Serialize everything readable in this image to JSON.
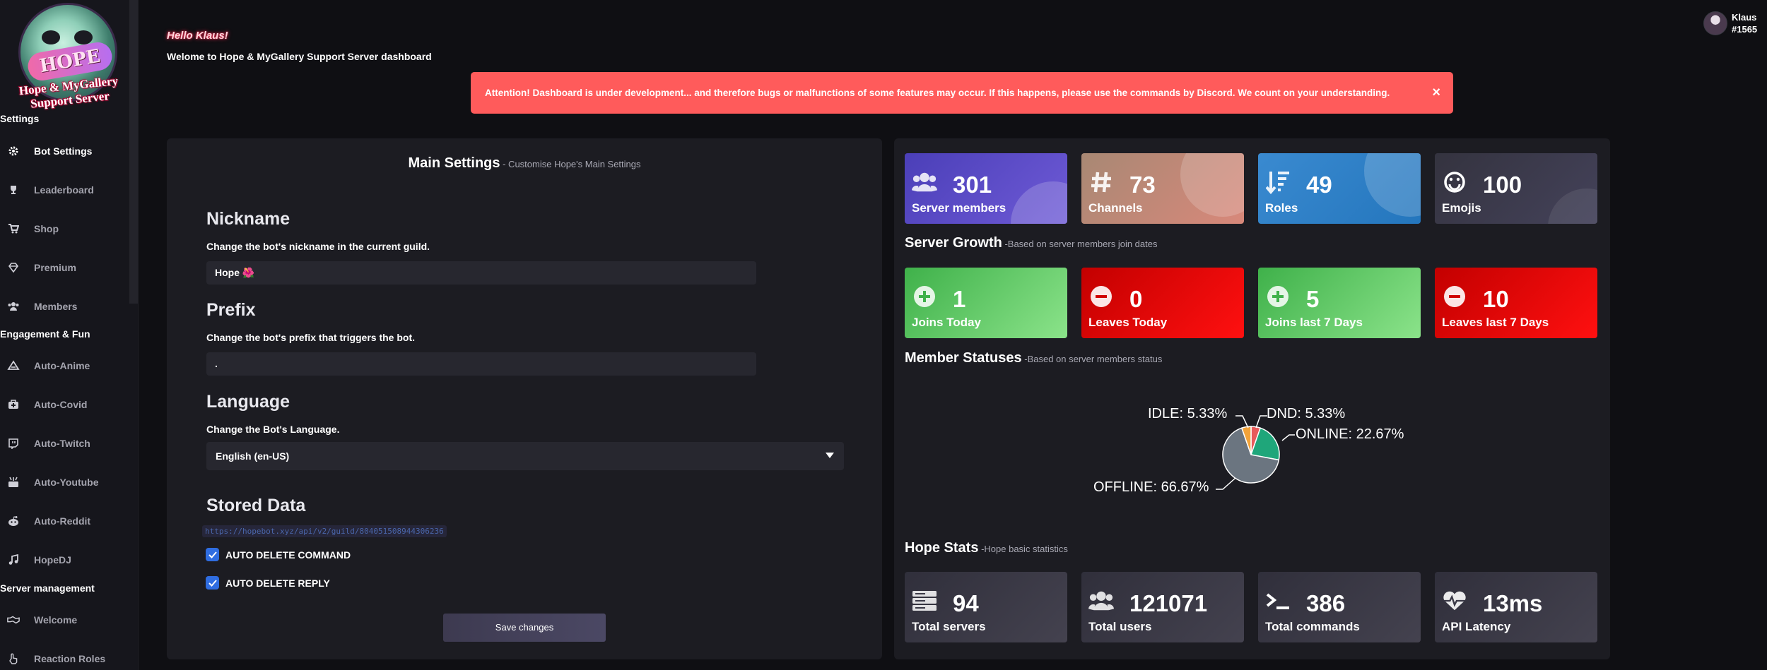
{
  "sidebar": {
    "logo_text_line1": "Hope & MyGallery",
    "logo_text_line2": "Support Server",
    "logo_banner": "HOPE",
    "groups": [
      "Settings",
      "Engagement & Fun",
      "Server management"
    ],
    "items": [
      {
        "label": "Bot Settings",
        "icon": "gear-icon"
      },
      {
        "label": "Leaderboard",
        "icon": "trophy-icon"
      },
      {
        "label": "Shop",
        "icon": "cart-icon"
      },
      {
        "label": "Premium",
        "icon": "diamond-icon"
      },
      {
        "label": "Members",
        "icon": "users-icon"
      },
      {
        "label": "Auto-Anime",
        "icon": "anime-icon"
      },
      {
        "label": "Auto-Covid",
        "icon": "medkit-icon"
      },
      {
        "label": "Auto-Twitch",
        "icon": "twitch-icon"
      },
      {
        "label": "Auto-Youtube",
        "icon": "youtube-icon"
      },
      {
        "label": "Auto-Reddit",
        "icon": "reddit-icon"
      },
      {
        "label": "HopeDJ",
        "icon": "music-icon"
      },
      {
        "label": "Welcome",
        "icon": "handshake-icon"
      },
      {
        "label": "Reaction Roles",
        "icon": "hand-pointer-icon"
      }
    ]
  },
  "header": {
    "hello": "Hello Klaus!",
    "welcome": "Welome to Hope & MyGallery Support Server dashboard",
    "user_name": "Klaus",
    "user_tag": "#1565"
  },
  "alert": {
    "text": "Attention! Dashboard is under development... and therefore bugs or malfunctions of some features may occur. If this happens, please use the commands by Discord. We count on your understanding.",
    "close": "×"
  },
  "settings": {
    "title": "Main Settings",
    "subtitle": " - Customise Hope's Main Settings",
    "nickname_heading": "Nickname",
    "nickname_desc": "Change the bot's nickname in the current guild.",
    "nickname_value": "Hope 🌺",
    "prefix_heading": "Prefix",
    "prefix_desc": "Change the bot's prefix that triggers the bot.",
    "prefix_value": ".",
    "language_heading": "Language",
    "language_desc": "Change the Bot's Language.",
    "language_value": "English (en-US)",
    "stored_heading": "Stored Data",
    "stored_url": "https://hopebot.xyz/api/v2/guild/804051508944306236",
    "auto_delete_command": "AUTO DELETE COMMAND",
    "auto_delete_reply": "AUTO DELETE REPLY",
    "save_label": "Save changes"
  },
  "stats": {
    "top_tiles": [
      {
        "value": "301",
        "label": "Server members",
        "icon": "users-icon",
        "color": "#5a4fc6"
      },
      {
        "value": "73",
        "label": "Channels",
        "icon": "hashtag-icon",
        "color": "#c38a7a"
      },
      {
        "value": "49",
        "label": "Roles",
        "icon": "sort-icon",
        "color": "#2f80c8"
      },
      {
        "value": "100",
        "label": "Emojis",
        "icon": "smile-icon",
        "color": "#3b3a4a"
      }
    ],
    "growth_title": "Server Growth",
    "growth_sub": " -Based on server members join dates",
    "growth_tiles": [
      {
        "value": "1",
        "label": "Joins Today",
        "icon": "plus-circle-icon",
        "color": "#4fc255"
      },
      {
        "value": "0",
        "label": "Leaves Today",
        "icon": "minus-circle-icon",
        "color": "#e00000"
      },
      {
        "value": "5",
        "label": "Joins last 7 Days",
        "icon": "plus-circle-icon",
        "color": "#4fc255"
      },
      {
        "value": "10",
        "label": "Leaves last 7 Days",
        "icon": "minus-circle-icon",
        "color": "#e00000"
      }
    ],
    "statuses_title": "Member Statuses",
    "statuses_sub": " -Based on server members status",
    "hope_title": "Hope Stats",
    "hope_sub": " -Hope basic statistics",
    "hope_tiles": [
      {
        "value": "94",
        "label": "Total servers",
        "icon": "server-icon"
      },
      {
        "value": "121071",
        "label": "Total users",
        "icon": "users-icon"
      },
      {
        "value": "386",
        "label": "Total commands",
        "icon": "terminal-icon"
      },
      {
        "value": "13ms",
        "label": "API Latency",
        "icon": "heartbeat-icon"
      }
    ]
  },
  "chart_data": {
    "type": "pie",
    "categories": [
      "OFFLINE",
      "ONLINE",
      "DND",
      "IDLE"
    ],
    "values": [
      66.67,
      22.67,
      5.33,
      5.33
    ],
    "labels": [
      "OFFLINE: 66.67%",
      "ONLINE: 22.67%",
      "DND: 5.33%",
      "IDLE: 5.33%"
    ],
    "colors": [
      "#6b7580",
      "#1fa67a",
      "#e85b5b",
      "#f2a33a"
    ]
  }
}
